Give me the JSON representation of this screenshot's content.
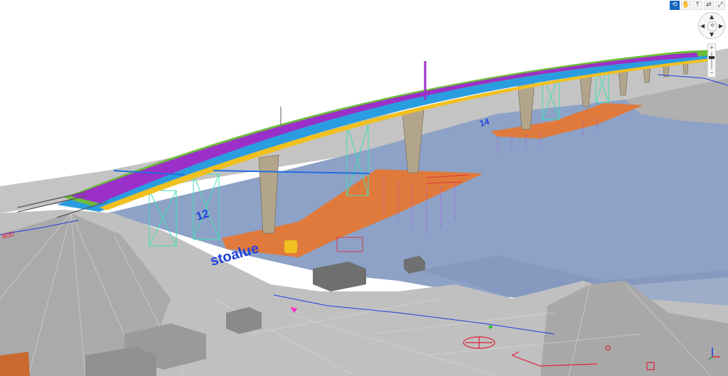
{
  "toolbar": {
    "tools": [
      {
        "name": "orbit-tool",
        "glyph": "⟲",
        "active": true
      },
      {
        "name": "pan-tool",
        "glyph": "✋",
        "active": false
      },
      {
        "name": "walk-tool",
        "glyph": "⇡",
        "active": false
      },
      {
        "name": "swap-tool",
        "glyph": "⇄",
        "active": false
      },
      {
        "name": "fullscreen-tool",
        "glyph": "⤢",
        "active": false
      }
    ]
  },
  "navigation": {
    "up": "▲",
    "down": "▼",
    "left": "◀",
    "right": "▶",
    "center": "⟲"
  },
  "zoom": {
    "plus": "+",
    "minus": "−",
    "level": 0.65
  },
  "scene_labels": {
    "water_label": "stoalue",
    "pier_label": "12",
    "pier_label_2": "14",
    "contour_label": "800"
  },
  "colors": {
    "sky": "#ffffff",
    "water": "#8da2c6",
    "terrain": "#b9b9b9",
    "deck_green": "#6dbb3a",
    "deck_purple": "#9b30c8",
    "deck_blue": "#2a9de0",
    "pier": "#b3a58c",
    "platform": "#e07a3c",
    "scaffold": "#3ee0b8",
    "annotation_blue": "#1f3fe0",
    "annotation_red": "#e0203a"
  }
}
